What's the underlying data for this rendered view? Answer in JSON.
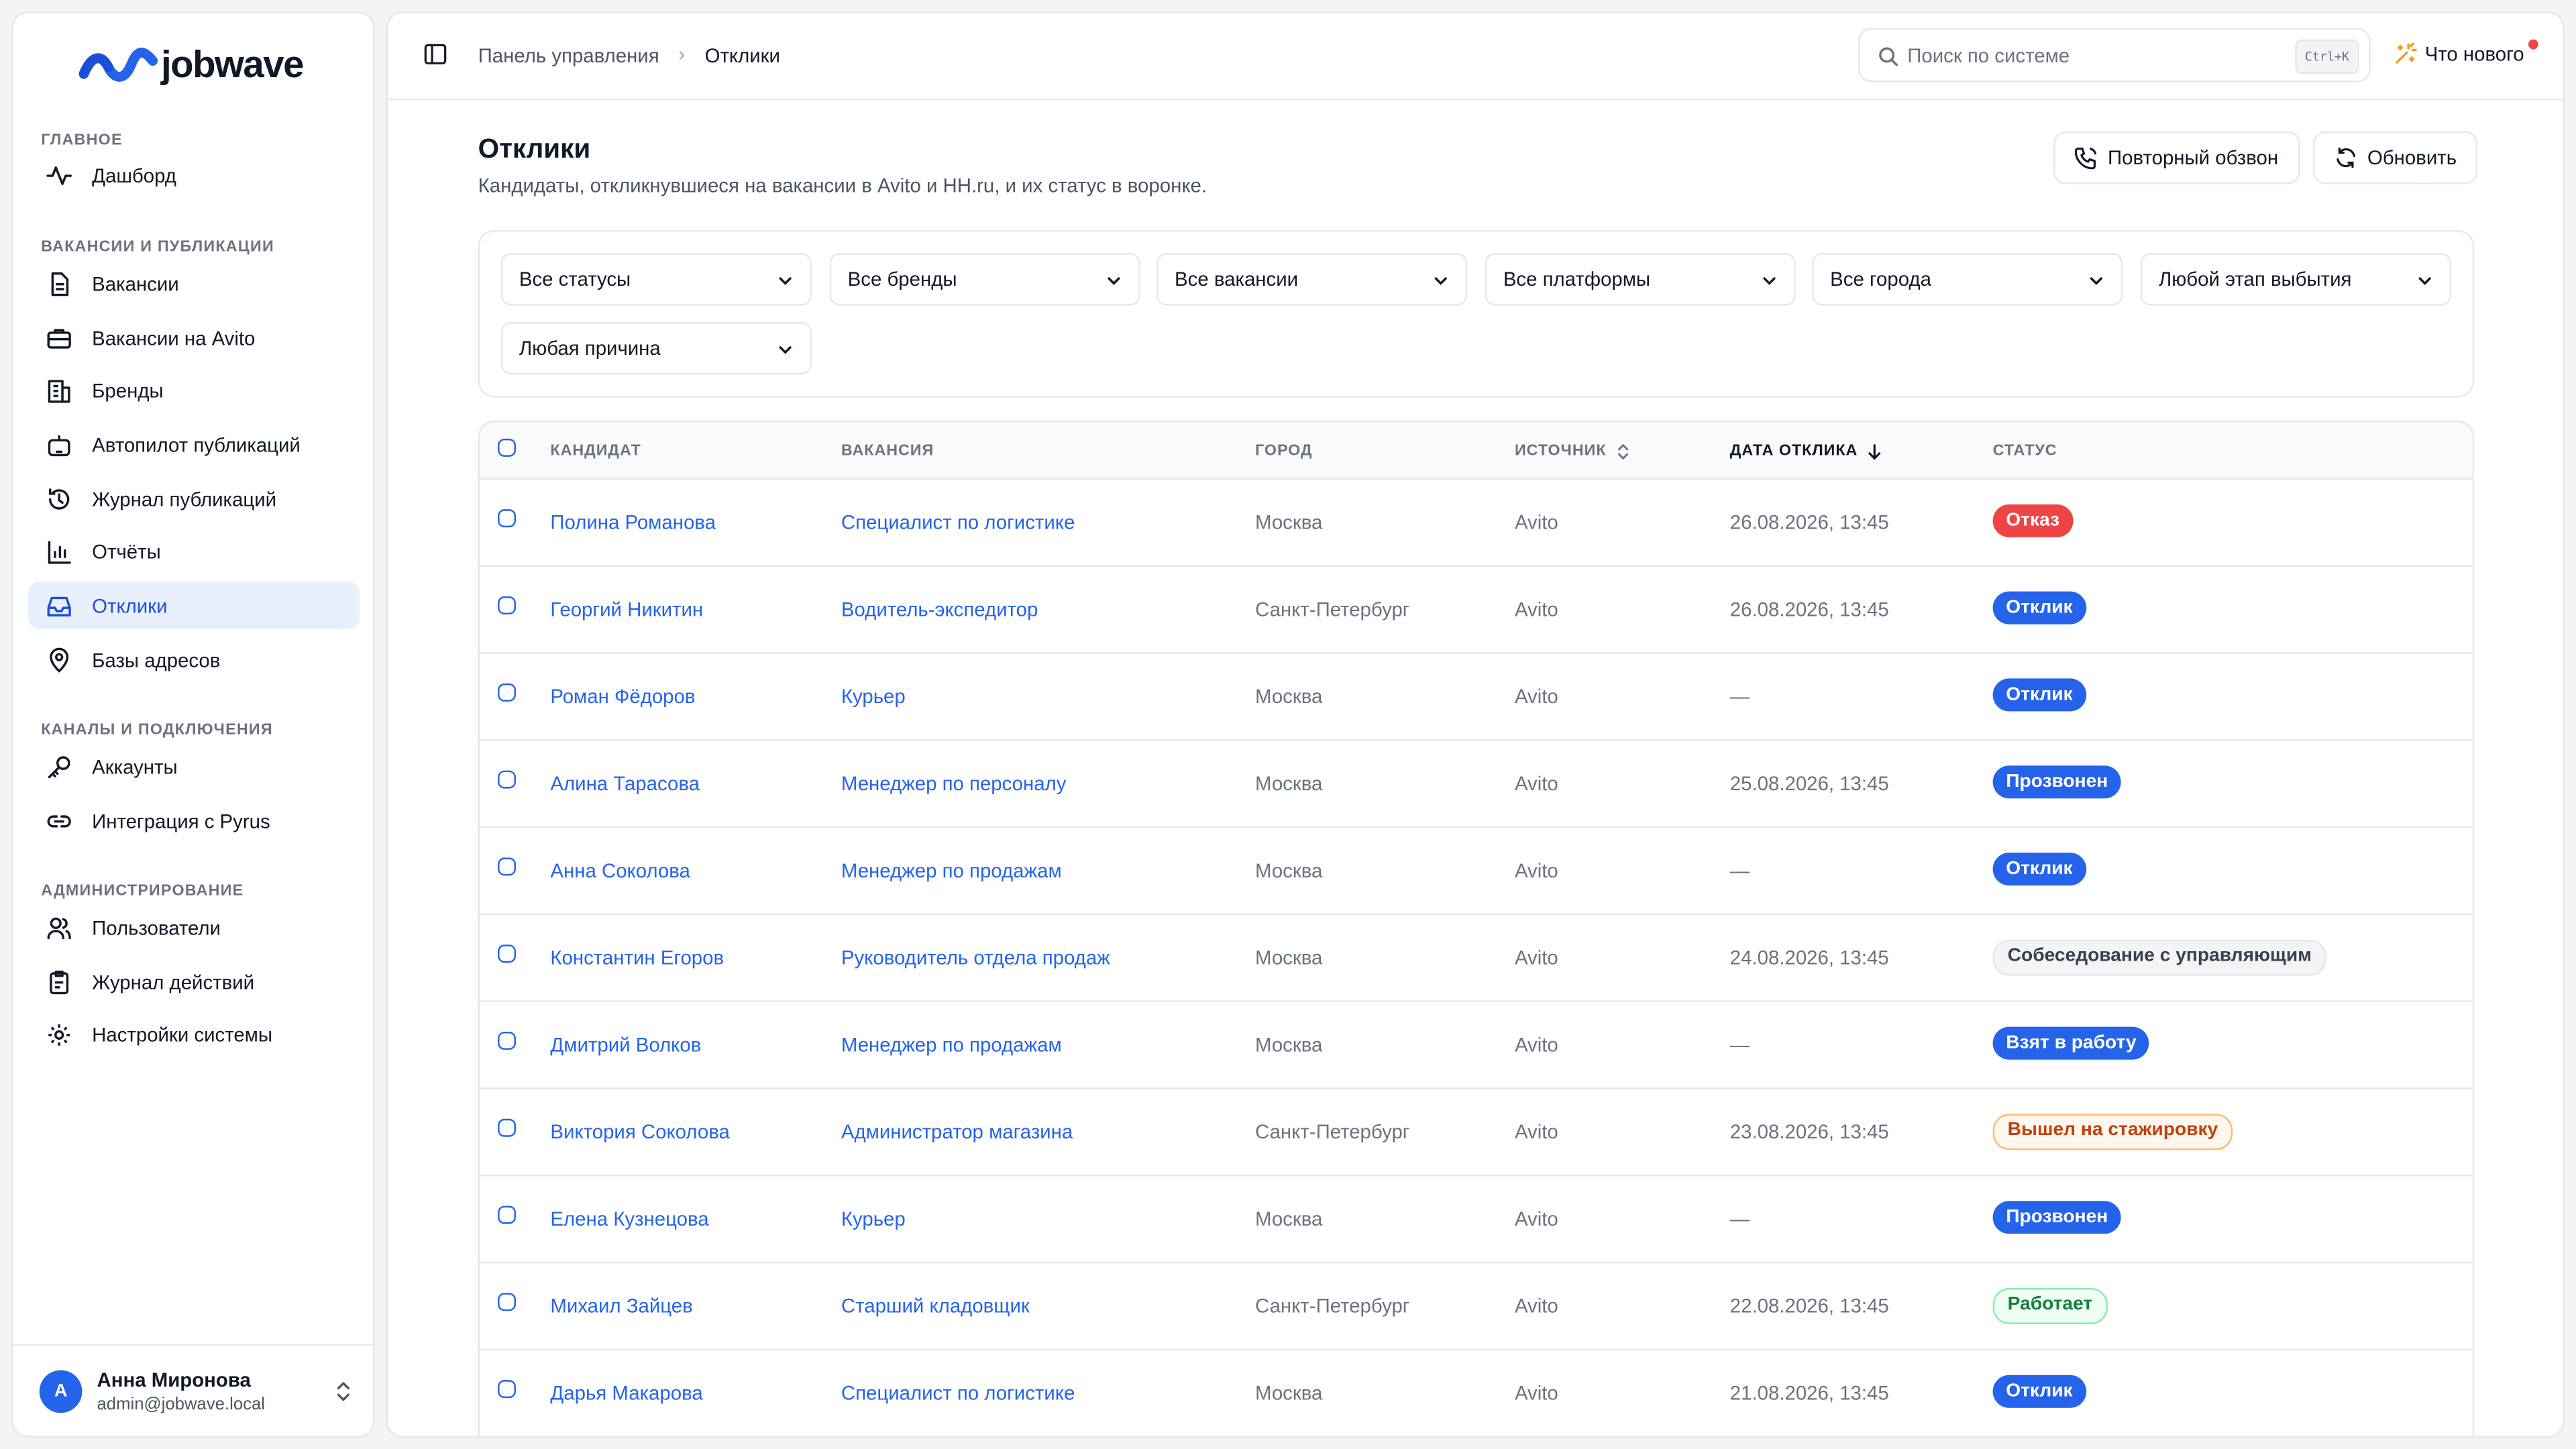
{
  "brand": {
    "logo_text": "jobwave",
    "accent": "#2563eb"
  },
  "sidebar": {
    "sections": [
      {
        "title": "Главное"
      },
      {
        "title": "Вакансии и публикации"
      },
      {
        "title": "Каналы и подключения"
      },
      {
        "title": "Администрирование"
      }
    ],
    "items": [
      {
        "label": "Дашборд",
        "icon": "activity-icon"
      },
      {
        "label": "Вакансии",
        "icon": "document-icon"
      },
      {
        "label": "Вакансии на Avito",
        "icon": "briefcase-icon"
      },
      {
        "label": "Бренды",
        "icon": "building-icon"
      },
      {
        "label": "Автопилот публикаций",
        "icon": "robot-icon"
      },
      {
        "label": "Журнал публикаций",
        "icon": "history-icon"
      },
      {
        "label": "Отчёты",
        "icon": "bar-chart-icon"
      },
      {
        "label": "Отклики",
        "icon": "inbox-icon",
        "active": true
      },
      {
        "label": "Базы адресов",
        "icon": "map-pin-icon"
      },
      {
        "label": "Аккаунты",
        "icon": "key-icon"
      },
      {
        "label": "Интеграция с Pyrus",
        "icon": "link-icon"
      },
      {
        "label": "Пользователи",
        "icon": "users-icon"
      },
      {
        "label": "Журнал действий",
        "icon": "clipboard-icon"
      },
      {
        "label": "Настройки системы",
        "icon": "gear-icon"
      }
    ],
    "user": {
      "initial": "А",
      "name": "Анна Миронова",
      "email": "admin@jobwave.local"
    }
  },
  "topbar": {
    "breadcrumb": [
      "Панель управления",
      "Отклики"
    ],
    "breadcrumb_sep": "›",
    "search_placeholder": "Поиск по системе",
    "search_shortcut": "Ctrl+K",
    "whats_new": "Что нового"
  },
  "page": {
    "title": "Отклики",
    "subtitle": "Кандидаты, откликнувшиеся на вакансии в Avito и HH.ru, и их статус в воронке.",
    "recall_button": "Повторный обзвон",
    "refresh_button": "Обновить"
  },
  "filters": [
    "Все статусы",
    "Все бренды",
    "Все вакансии",
    "Все платформы",
    "Все города",
    "Любой этап выбытия",
    "Любая причина"
  ],
  "table": {
    "columns": [
      "Кандидат",
      "Вакансия",
      "Город",
      "Источник",
      "Дата отклика",
      "Статус"
    ],
    "rows": [
      {
        "candidate": "Полина Романова",
        "vacancy": "Специалист по логистике",
        "city": "Москва",
        "source": "Avito",
        "date": "26.08.2026, 13:45",
        "status": "Отказ",
        "status_type": "red"
      },
      {
        "candidate": "Георгий Никитин",
        "vacancy": "Водитель-экспедитор",
        "city": "Санкт-Петербург",
        "source": "Avito",
        "date": "26.08.2026, 13:45",
        "status": "Отклик",
        "status_type": "blue"
      },
      {
        "candidate": "Роман Фёдоров",
        "vacancy": "Курьер",
        "city": "Москва",
        "source": "Avito",
        "date": "—",
        "status": "Отклик",
        "status_type": "blue"
      },
      {
        "candidate": "Алина Тарасова",
        "vacancy": "Менеджер по персоналу",
        "city": "Москва",
        "source": "Avito",
        "date": "25.08.2026, 13:45",
        "status": "Прозвонен",
        "status_type": "blue"
      },
      {
        "candidate": "Анна Соколова",
        "vacancy": "Менеджер по продажам",
        "city": "Москва",
        "source": "Avito",
        "date": "—",
        "status": "Отклик",
        "status_type": "blue"
      },
      {
        "candidate": "Константин Егоров",
        "vacancy": "Руководитель отдела продаж",
        "city": "Москва",
        "source": "Avito",
        "date": "24.08.2026, 13:45",
        "status": "Собеседование с управляющим",
        "status_type": "gray"
      },
      {
        "candidate": "Дмитрий Волков",
        "vacancy": "Менеджер по продажам",
        "city": "Москва",
        "source": "Avito",
        "date": "—",
        "status": "Взят в работу",
        "status_type": "blue"
      },
      {
        "candidate": "Виктория Соколова",
        "vacancy": "Администратор магазина",
        "city": "Санкт-Петербург",
        "source": "Avito",
        "date": "23.08.2026, 13:45",
        "status": "Вышел на стажировку",
        "status_type": "orange"
      },
      {
        "candidate": "Елена Кузнецова",
        "vacancy": "Курьер",
        "city": "Москва",
        "source": "Avito",
        "date": "—",
        "status": "Прозвонен",
        "status_type": "blue"
      },
      {
        "candidate": "Михаил Зайцев",
        "vacancy": "Старший кладовщик",
        "city": "Санкт-Петербург",
        "source": "Avito",
        "date": "22.08.2026, 13:45",
        "status": "Работает",
        "status_type": "green"
      },
      {
        "candidate": "Дарья Макарова",
        "vacancy": "Специалист по логистике",
        "city": "Москва",
        "source": "Avito",
        "date": "21.08.2026, 13:45",
        "status": "Отклик",
        "status_type": "blue"
      }
    ]
  }
}
